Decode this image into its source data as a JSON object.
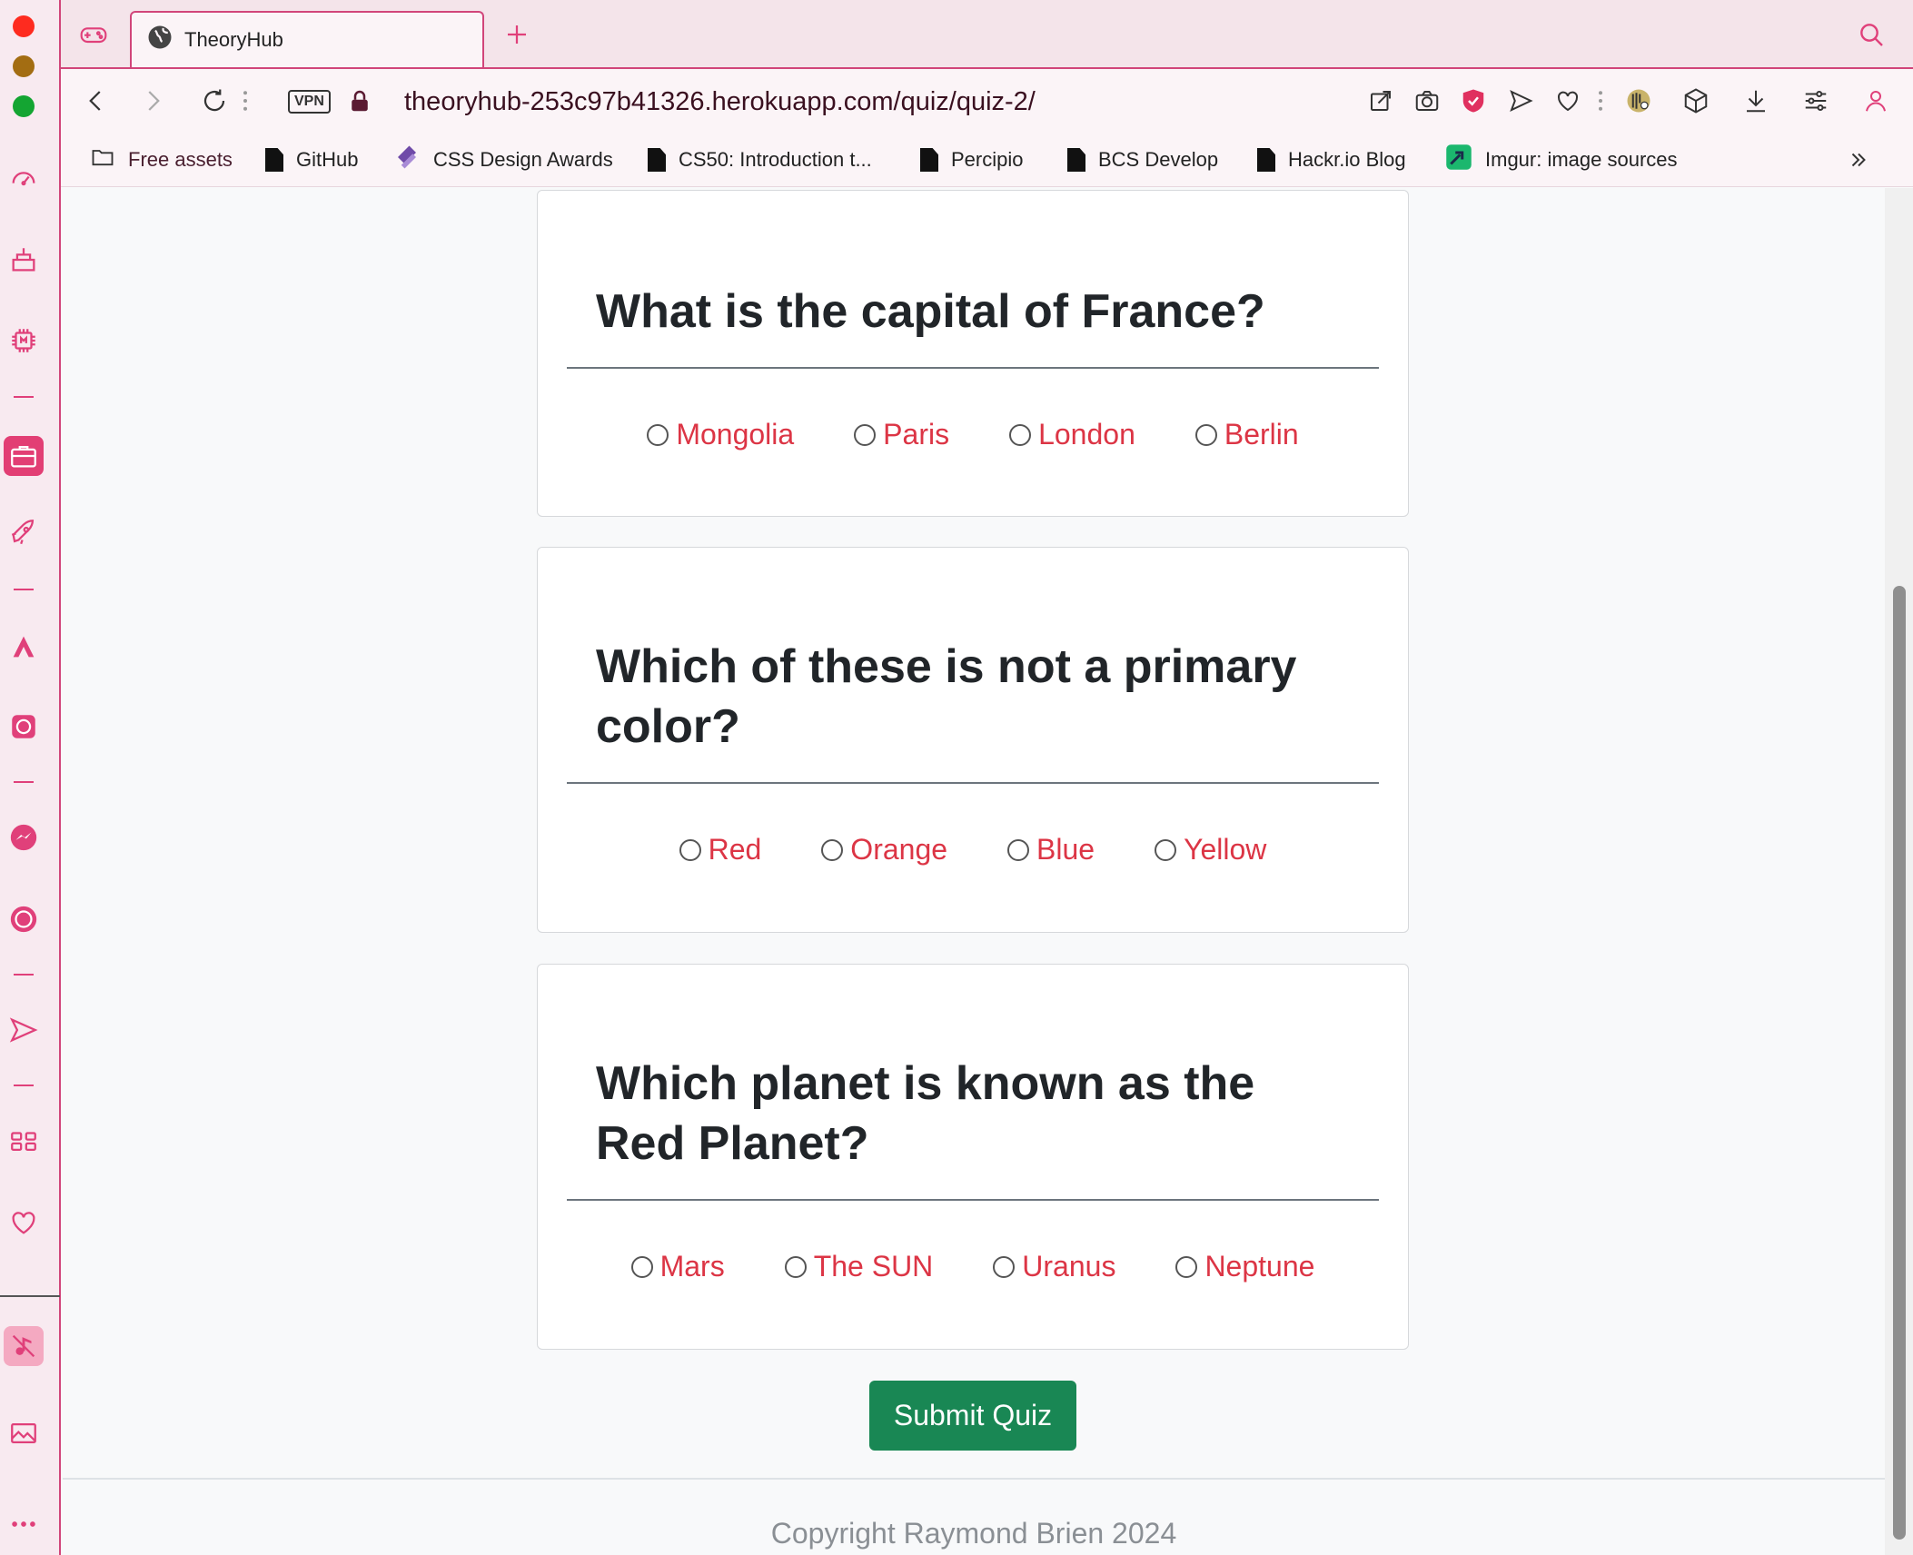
{
  "browser": {
    "tab": {
      "title": "TheoryHub"
    },
    "url": "theoryhub-253c97b41326.herokuapp.com/quiz/quiz-2/",
    "vpn_label": "VPN",
    "bookmarks": [
      {
        "label": "Free assets",
        "icon": "folder-icon"
      },
      {
        "label": "GitHub",
        "icon": "document-icon"
      },
      {
        "label": "CSS Design Awards",
        "icon": "cssda-icon"
      },
      {
        "label": "CS50: Introduction t...",
        "icon": "document-icon"
      },
      {
        "label": "Percipio",
        "icon": "document-icon"
      },
      {
        "label": "BCS Develop",
        "icon": "document-icon"
      },
      {
        "label": "Hackr.io Blog",
        "icon": "document-icon"
      },
      {
        "label": "Imgur: image sources",
        "icon": "imgur-icon"
      }
    ],
    "accent_color": "#e0407a"
  },
  "quiz": {
    "questions": [
      {
        "text": "What is the capital of France?",
        "options": [
          "Mongolia",
          "Paris",
          "London",
          "Berlin"
        ]
      },
      {
        "text": "Which of these is not a primary color?",
        "options": [
          "Red",
          "Orange",
          "Blue",
          "Yellow"
        ]
      },
      {
        "text": "Which planet is known as the Red Planet?",
        "options": [
          "Mars",
          "The SUN",
          "Uranus",
          "Neptune"
        ]
      }
    ],
    "submit_label": "Submit Quiz",
    "option_color": "#dc3545",
    "button_color": "#198754"
  },
  "footer": {
    "copyright": "Copyright Raymond Brien 2024"
  }
}
